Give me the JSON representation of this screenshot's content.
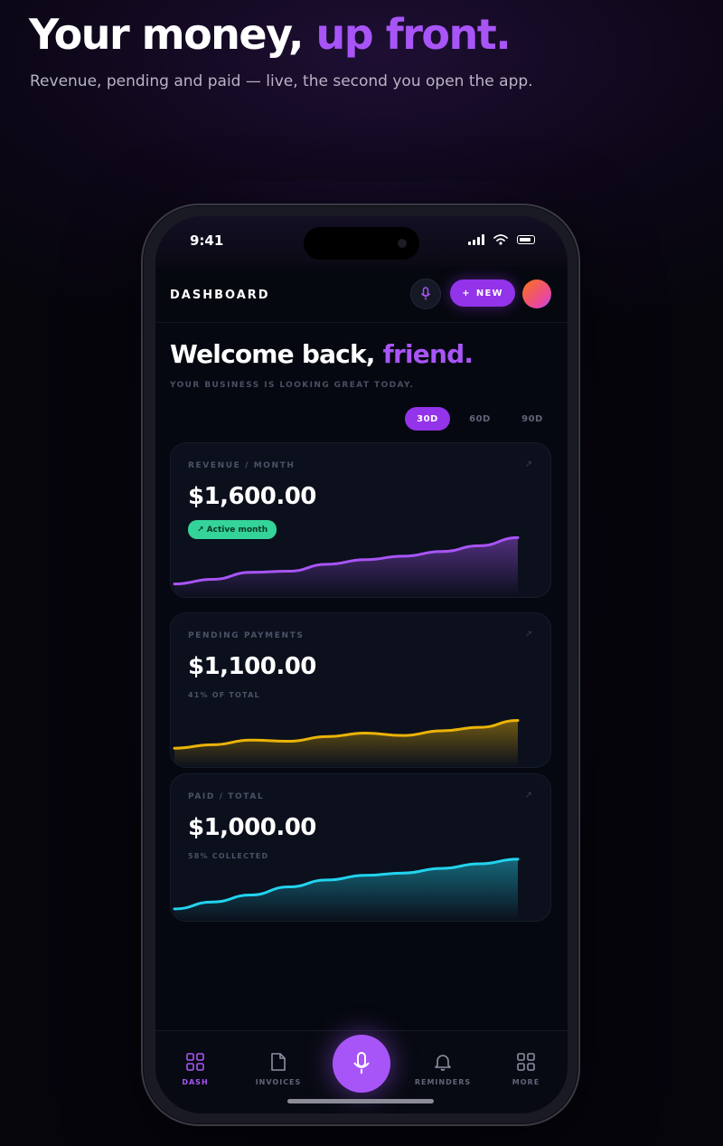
{
  "hero": {
    "title_main": "Your money, ",
    "title_accent": "up front.",
    "subtitle": "Revenue, pending and paid — live, the second you open the app."
  },
  "status_bar": {
    "time": "9:41"
  },
  "topbar": {
    "title": "DASHBOARD",
    "mic_icon": "mic-icon",
    "new_button": {
      "icon": "+",
      "label": "NEW"
    }
  },
  "welcome": {
    "greeting": "Welcome back, ",
    "name": "friend.",
    "subtitle": "YOUR BUSINESS IS LOOKING GREAT TODAY."
  },
  "periods": [
    {
      "label": "30D",
      "active": true
    },
    {
      "label": "60D",
      "active": false
    },
    {
      "label": "90D",
      "active": false
    }
  ],
  "cards": [
    {
      "label": "REVENUE / MONTH",
      "value": "$1,600.00",
      "badge": "↗ Active month",
      "color": "#a855f7",
      "trend": [
        10,
        18,
        30,
        32,
        44,
        52,
        58,
        66,
        76,
        90
      ]
    },
    {
      "label": "PENDING PAYMENTS",
      "value": "$1,100.00",
      "note": "41% OF TOTAL",
      "color": "#eab308",
      "trend": [
        20,
        26,
        34,
        32,
        40,
        46,
        42,
        50,
        56,
        68
      ]
    },
    {
      "label": "PAID / TOTAL",
      "value": "$1,000.00",
      "note": "58% COLLECTED",
      "color": "#22d3ee",
      "trend": [
        8,
        20,
        32,
        46,
        58,
        66,
        70,
        78,
        86,
        94
      ]
    }
  ],
  "bottom_nav": {
    "items": [
      {
        "label": "DASH",
        "icon": "grid-icon",
        "active": true
      },
      {
        "label": "INVOICES",
        "icon": "document-icon",
        "active": false
      },
      {
        "label": "REMINDERS",
        "icon": "bell-icon",
        "active": false
      },
      {
        "label": "MORE",
        "icon": "grid-icon",
        "active": false
      }
    ],
    "center_icon": "mic-icon"
  },
  "colors": {
    "accent": "#a855f7",
    "button": "#9333ea",
    "success": "#34d399",
    "background": "#050810"
  }
}
